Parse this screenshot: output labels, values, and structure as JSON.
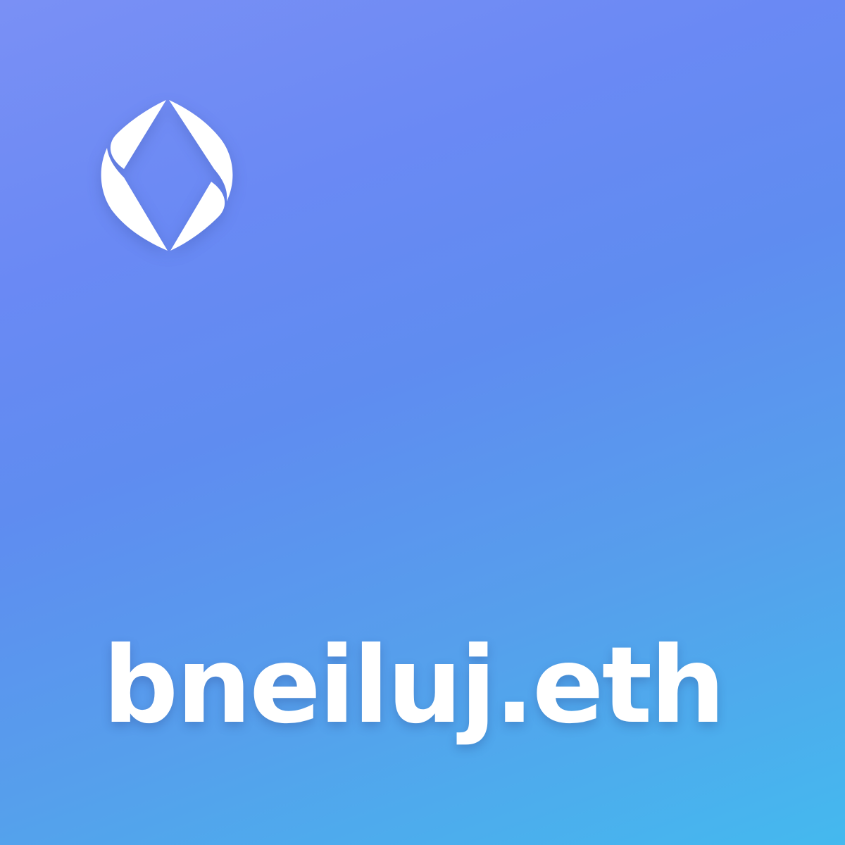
{
  "card": {
    "logo_icon": "ens-logo-icon",
    "name": "bneiluj.eth",
    "colors": {
      "gradient_start": "#7a90f5",
      "gradient_mid": "#5f8cf0",
      "gradient_end": "#44b9ee",
      "text": "#ffffff"
    }
  }
}
